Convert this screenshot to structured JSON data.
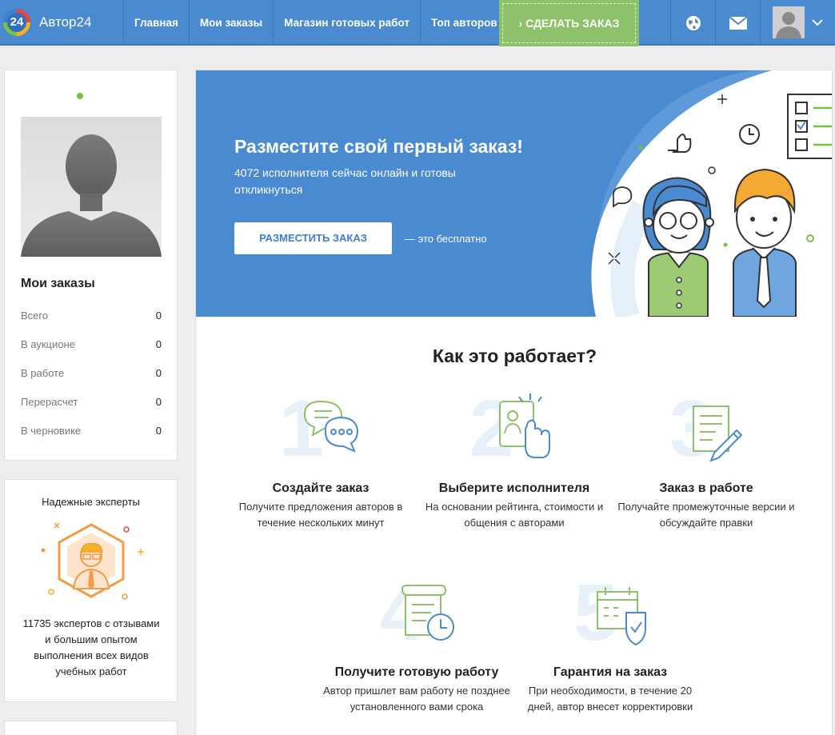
{
  "header": {
    "logo_num": "24",
    "logo_text": "Автор24",
    "nav": [
      "Главная",
      "Мои заказы",
      "Магазин готовых работ",
      "Топ авторов"
    ],
    "order_button": "› СДЕЛАТЬ ЗАКАЗ",
    "icons": [
      "globe-icon",
      "mail-icon",
      "avatar",
      "chevron-down-icon"
    ]
  },
  "sidebar": {
    "orders_title": "Мои заказы",
    "stats": [
      {
        "label": "Всего",
        "value": "0"
      },
      {
        "label": "В аукционе",
        "value": "0"
      },
      {
        "label": "В работе",
        "value": "0"
      },
      {
        "label": "Перерасчет",
        "value": "0"
      },
      {
        "label": "В черновике",
        "value": "0"
      }
    ],
    "experts_title": "Надежные эксперты",
    "experts_desc": "11735 экспертов с отзывами и большим опытом выполнения всех видов учебных работ"
  },
  "hero": {
    "title": "Разместите свой первый заказ!",
    "subtitle": "4072 исполнителя сейчас онлайн и готовы откликнуться",
    "button": "РАЗМЕСТИТЬ ЗАКАЗ",
    "free_note": "— это бесплатно"
  },
  "how": {
    "title": "Как это работает?",
    "steps": [
      {
        "num": "1",
        "title": "Создайте заказ",
        "desc": "Получите предложения авторов в течение нескольких минут"
      },
      {
        "num": "2",
        "title": "Выберите исполнителя",
        "desc": "На основании рейтинга, стоимости и общения с авторами"
      },
      {
        "num": "3",
        "title": "Заказ в работе",
        "desc": "Получайте промежуточные версии и обсуждайте правки"
      },
      {
        "num": "4",
        "title": "Получите готовую работу",
        "desc": "Автор пришлет вам работу не позднее установленного вами срока"
      },
      {
        "num": "5",
        "title": "Гарантия на заказ",
        "desc": "При необходимости, в течение 20 дней, автор внесет корректировки"
      }
    ]
  },
  "colors": {
    "brand_blue": "#4a8ad0",
    "accent_green": "#8dc26a",
    "orange": "#f39c45"
  }
}
